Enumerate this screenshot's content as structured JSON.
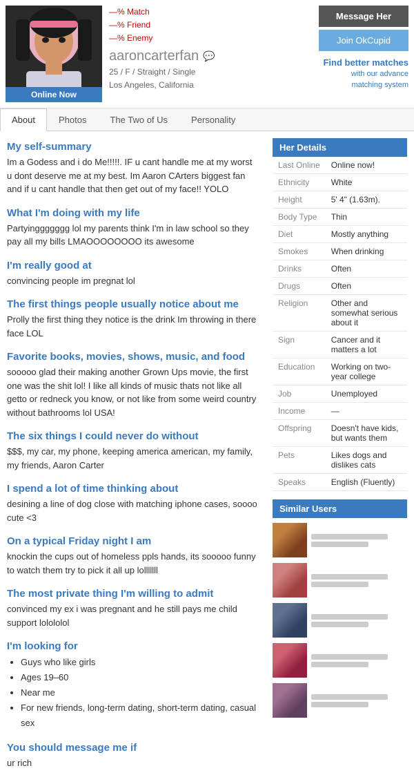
{
  "header": {
    "match_percent": "—% Match",
    "friend_percent": "—% Friend",
    "enemy_percent": "—% Enemy",
    "username": "aaroncarterfan",
    "age": "25",
    "gender": "F",
    "orientation": "Straight",
    "status": "Single",
    "location": "Los Angeles, California",
    "online_badge": "Online Now",
    "message_button": "Message Her",
    "join_button": "Join OkCupid",
    "find_better_main": "Find better matches",
    "find_better_sub": "with our advance matching system"
  },
  "tabs": {
    "about": "About",
    "photos": "Photos",
    "two_of_us": "The Two of Us",
    "personality": "Personality"
  },
  "sections": {
    "self_summary_title": "My self-summary",
    "self_summary_text": "Im a Godess and i do Me!!!!!. IF u cant handle me at my worst u dont deserve me at my best. Im Aaron CArters biggest fan and if u cant handle that then get out of my face!! YOLO",
    "doing_life_title": "What I'm doing with my life",
    "doing_life_text": "Partyinggggggg lol my parents think I'm in law school so they pay all my bills LMAOOOOOOOO its awesome",
    "good_at_title": "I'm really good at",
    "good_at_text": "convincing people im pregnat lol",
    "notice_title": "The first things people usually notice about me",
    "notice_text": "Prolly the first thing they notice is the drink Im throwing in there face LOL",
    "favorites_title": "Favorite books, movies, shows, music, and food",
    "favorites_text": "sooooo glad their making another Grown Ups movie, the first one was the shit lol! I like all kinds of music thats not like all getto or redneck you know, or not like from some weird country without bathrooms lol USA!",
    "six_things_title": "The six things I could never do without",
    "six_things_text": "$$$, my car, my phone, keeping america american, my family, my friends, Aaron Carter",
    "thinking_title": "I spend a lot of time thinking about",
    "thinking_text": "desining a line of dog close with matching iphone cases, soooo cute <3",
    "friday_title": "On a typical Friday night I am",
    "friday_text": "knockin the cups out of homeless ppls hands, its sooooo funny to watch them try to pick it all up lolllllll",
    "private_title": "The most private thing I'm willing to admit",
    "private_text": "convinced my ex i was pregnant and he still pays me child support lolololol",
    "looking_title": "I'm looking for",
    "looking_items": [
      "Guys who like girls",
      "Ages 19–60",
      "Near me",
      "For new friends, long-term dating, short-term dating, casual sex"
    ],
    "message_title": "You should message me if",
    "message_text": "ur rich"
  },
  "details": {
    "header": "Her Details",
    "rows": [
      {
        "label": "Last Online",
        "value": "Online now!"
      },
      {
        "label": "Ethnicity",
        "value": "White"
      },
      {
        "label": "Height",
        "value": "5' 4\" (1.63m)."
      },
      {
        "label": "Body Type",
        "value": "Thin"
      },
      {
        "label": "Diet",
        "value": "Mostly anything"
      },
      {
        "label": "Smokes",
        "value": "When drinking"
      },
      {
        "label": "Drinks",
        "value": "Often"
      },
      {
        "label": "Drugs",
        "value": "Often"
      },
      {
        "label": "Religion",
        "value": "Other and somewhat serious about it"
      },
      {
        "label": "Sign",
        "value": "Cancer and it matters a lot"
      },
      {
        "label": "Education",
        "value": "Working on two-year college"
      },
      {
        "label": "Job",
        "value": "Unemployed"
      },
      {
        "label": "Income",
        "value": "—"
      },
      {
        "label": "Offspring",
        "value": "Doesn't have kids, but wants them"
      },
      {
        "label": "Pets",
        "value": "Likes dogs and dislikes cats"
      },
      {
        "label": "Speaks",
        "value": "English (Fluently)"
      }
    ]
  },
  "similar_users": {
    "header": "Similar Users",
    "count": 5
  }
}
